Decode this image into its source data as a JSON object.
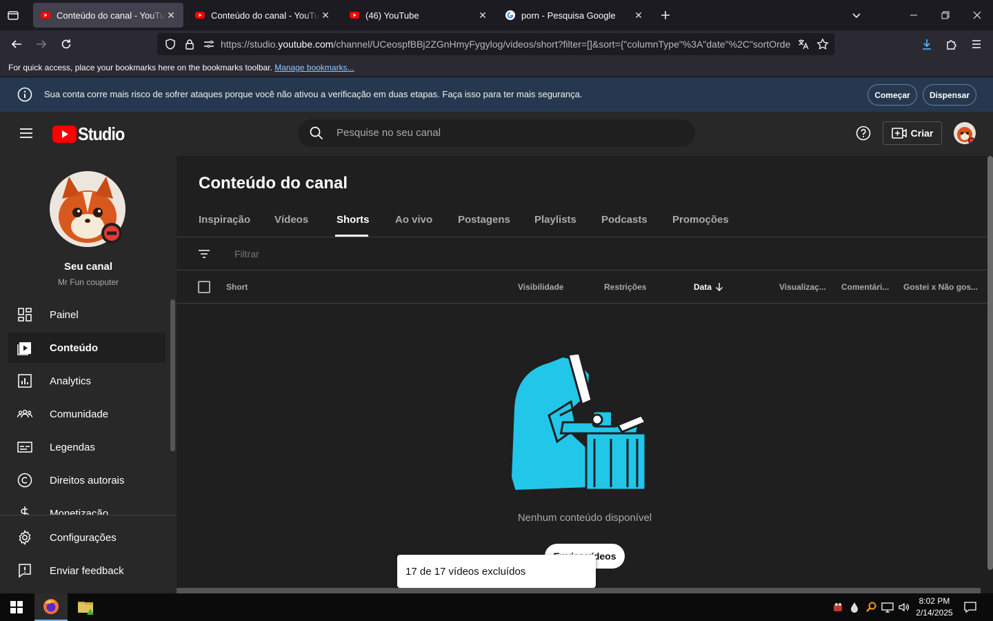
{
  "browser": {
    "tabs": [
      {
        "title": "Conteúdo do canal - YouTube Studio",
        "active": true,
        "favicon": "youtube-icon"
      },
      {
        "title": "Conteúdo do canal - YouTube Studio",
        "active": false,
        "favicon": "youtube-icon"
      },
      {
        "title": "(46) YouTube",
        "active": false,
        "favicon": "youtube-icon"
      },
      {
        "title": "porn - Pesquisa Google",
        "active": false,
        "favicon": "google-icon"
      }
    ],
    "url_prefix": "https://studio.",
    "url_domain": "youtube.com",
    "url_rest": "/channel/UCeospfBBj2ZGnHmyFygylog/videos/short?filter=[]&sort={\"columnType\"%3A\"date\"%2C\"sortOrder\"",
    "bookmarks_text": "For quick access, place your bookmarks here on the bookmarks toolbar.",
    "bookmarks_link": "Manage bookmarks..."
  },
  "banner": {
    "text": "Sua conta corre mais risco de sofrer ataques porque você não ativou a verificação em duas etapas. Faça isso para ter mais segurança.",
    "start_label": "Começar",
    "dismiss_label": "Dispensar"
  },
  "header": {
    "logo_text": "Studio",
    "search_placeholder": "Pesquise no seu canal",
    "create_label": "Criar"
  },
  "channel": {
    "title": "Seu canal",
    "name": "Mr Fun couputer"
  },
  "sidebar": {
    "items": [
      {
        "label": "Painel",
        "icon": "dashboard-icon"
      },
      {
        "label": "Conteúdo",
        "icon": "content-icon",
        "active": true
      },
      {
        "label": "Analytics",
        "icon": "analytics-icon"
      },
      {
        "label": "Comunidade",
        "icon": "community-icon"
      },
      {
        "label": "Legendas",
        "icon": "subtitles-icon"
      },
      {
        "label": "Direitos autorais",
        "icon": "copyright-icon"
      },
      {
        "label": "Monetização",
        "icon": "monetization-icon"
      }
    ],
    "settings_label": "Configurações",
    "feedback_label": "Enviar feedback"
  },
  "main": {
    "title": "Conteúdo do canal",
    "tabs": [
      "Inspiração",
      "Vídeos",
      "Shorts",
      "Ao vivo",
      "Postagens",
      "Playlists",
      "Podcasts",
      "Promoções"
    ],
    "active_tab": "Shorts",
    "filter_placeholder": "Filtrar",
    "columns": [
      "Short",
      "Visibilidade",
      "Restrições",
      "Data",
      "Visualizaç...",
      "Comentári...",
      "Gostei x Não gos..."
    ],
    "empty_text": "Nenhum conteúdo disponível",
    "upload_label": "Enviar vídeos",
    "toast": "17 de 17 vídeos excluídos"
  },
  "taskbar": {
    "time": "8:02 PM",
    "date": "2/14/2025"
  },
  "colors": {
    "accent_red": "#ff0000",
    "banner_bg": "#263850",
    "link_blue": "#8fc8ff",
    "illustration_cyan": "#22c6e8"
  }
}
